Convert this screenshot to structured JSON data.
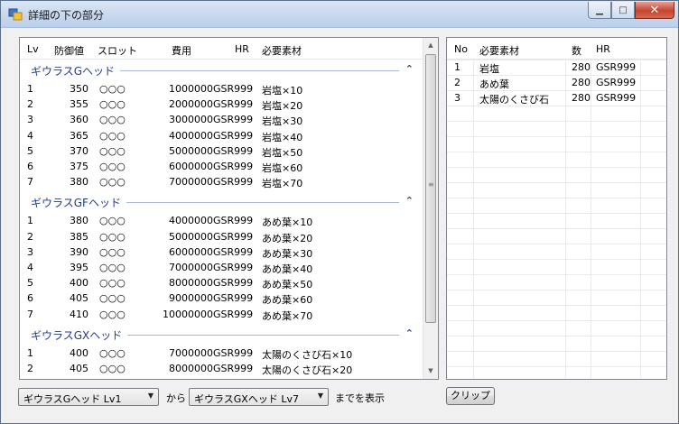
{
  "window": {
    "title": "詳細の下の部分"
  },
  "detail_list": {
    "headers": {
      "lv": "Lv",
      "defense": "防御値",
      "slot": "スロット",
      "cost": "費用",
      "hr": "HR",
      "material": "必要素材"
    },
    "groups": [
      {
        "title": "ギウラスGヘッド",
        "rows": [
          {
            "lv": "1",
            "defense": "350",
            "slot": "○○○",
            "cost": "1000000",
            "hr": "GSR999",
            "material": "岩塩×10"
          },
          {
            "lv": "2",
            "defense": "355",
            "slot": "○○○",
            "cost": "2000000",
            "hr": "GSR999",
            "material": "岩塩×20"
          },
          {
            "lv": "3",
            "defense": "360",
            "slot": "○○○",
            "cost": "3000000",
            "hr": "GSR999",
            "material": "岩塩×30"
          },
          {
            "lv": "4",
            "defense": "365",
            "slot": "○○○",
            "cost": "4000000",
            "hr": "GSR999",
            "material": "岩塩×40"
          },
          {
            "lv": "5",
            "defense": "370",
            "slot": "○○○",
            "cost": "5000000",
            "hr": "GSR999",
            "material": "岩塩×50"
          },
          {
            "lv": "6",
            "defense": "375",
            "slot": "○○○",
            "cost": "6000000",
            "hr": "GSR999",
            "material": "岩塩×60"
          },
          {
            "lv": "7",
            "defense": "380",
            "slot": "○○○",
            "cost": "7000000",
            "hr": "GSR999",
            "material": "岩塩×70"
          }
        ]
      },
      {
        "title": "ギウラスGFヘッド",
        "rows": [
          {
            "lv": "1",
            "defense": "380",
            "slot": "○○○",
            "cost": "4000000",
            "hr": "GSR999",
            "material": "あめ葉×10"
          },
          {
            "lv": "2",
            "defense": "385",
            "slot": "○○○",
            "cost": "5000000",
            "hr": "GSR999",
            "material": "あめ葉×20"
          },
          {
            "lv": "3",
            "defense": "390",
            "slot": "○○○",
            "cost": "6000000",
            "hr": "GSR999",
            "material": "あめ葉×30"
          },
          {
            "lv": "4",
            "defense": "395",
            "slot": "○○○",
            "cost": "7000000",
            "hr": "GSR999",
            "material": "あめ葉×40"
          },
          {
            "lv": "5",
            "defense": "400",
            "slot": "○○○",
            "cost": "8000000",
            "hr": "GSR999",
            "material": "あめ葉×50"
          },
          {
            "lv": "6",
            "defense": "405",
            "slot": "○○○",
            "cost": "9000000",
            "hr": "GSR999",
            "material": "あめ葉×60"
          },
          {
            "lv": "7",
            "defense": "410",
            "slot": "○○○",
            "cost": "10000000",
            "hr": "GSR999",
            "material": "あめ葉×70"
          }
        ]
      },
      {
        "title": "ギウラスGXヘッド",
        "rows": [
          {
            "lv": "1",
            "defense": "400",
            "slot": "○○○",
            "cost": "7000000",
            "hr": "GSR999",
            "material": "太陽のくさび石×10"
          },
          {
            "lv": "2",
            "defense": "405",
            "slot": "○○○",
            "cost": "8000000",
            "hr": "GSR999",
            "material": "太陽のくさび石×20"
          }
        ]
      }
    ]
  },
  "materials_grid": {
    "headers": {
      "no": "No",
      "material": "必要素材",
      "count": "数",
      "hr": "HR"
    },
    "rows": [
      {
        "no": "1",
        "material": "岩塩",
        "count": "280",
        "hr": "GSR999"
      },
      {
        "no": "2",
        "material": "あめ葉",
        "count": "280",
        "hr": "GSR999"
      },
      {
        "no": "3",
        "material": "太陽のくさび石",
        "count": "280",
        "hr": "GSR999"
      }
    ]
  },
  "footer": {
    "from_select": "ギウラスGヘッド Lv1",
    "from_label": "から",
    "to_select": "ギウラスGXヘッド Lv7",
    "to_label": "までを表示",
    "clip_button": "クリップ"
  },
  "icons": {
    "collapse": "chevron-up-icon",
    "dropdown": "chevron-down-icon",
    "minimize": "minimize-icon",
    "maximize": "maximize-icon",
    "close": "close-icon"
  },
  "colors": {
    "group_title": "#1e3d8f",
    "close_button": "#c7422f"
  }
}
